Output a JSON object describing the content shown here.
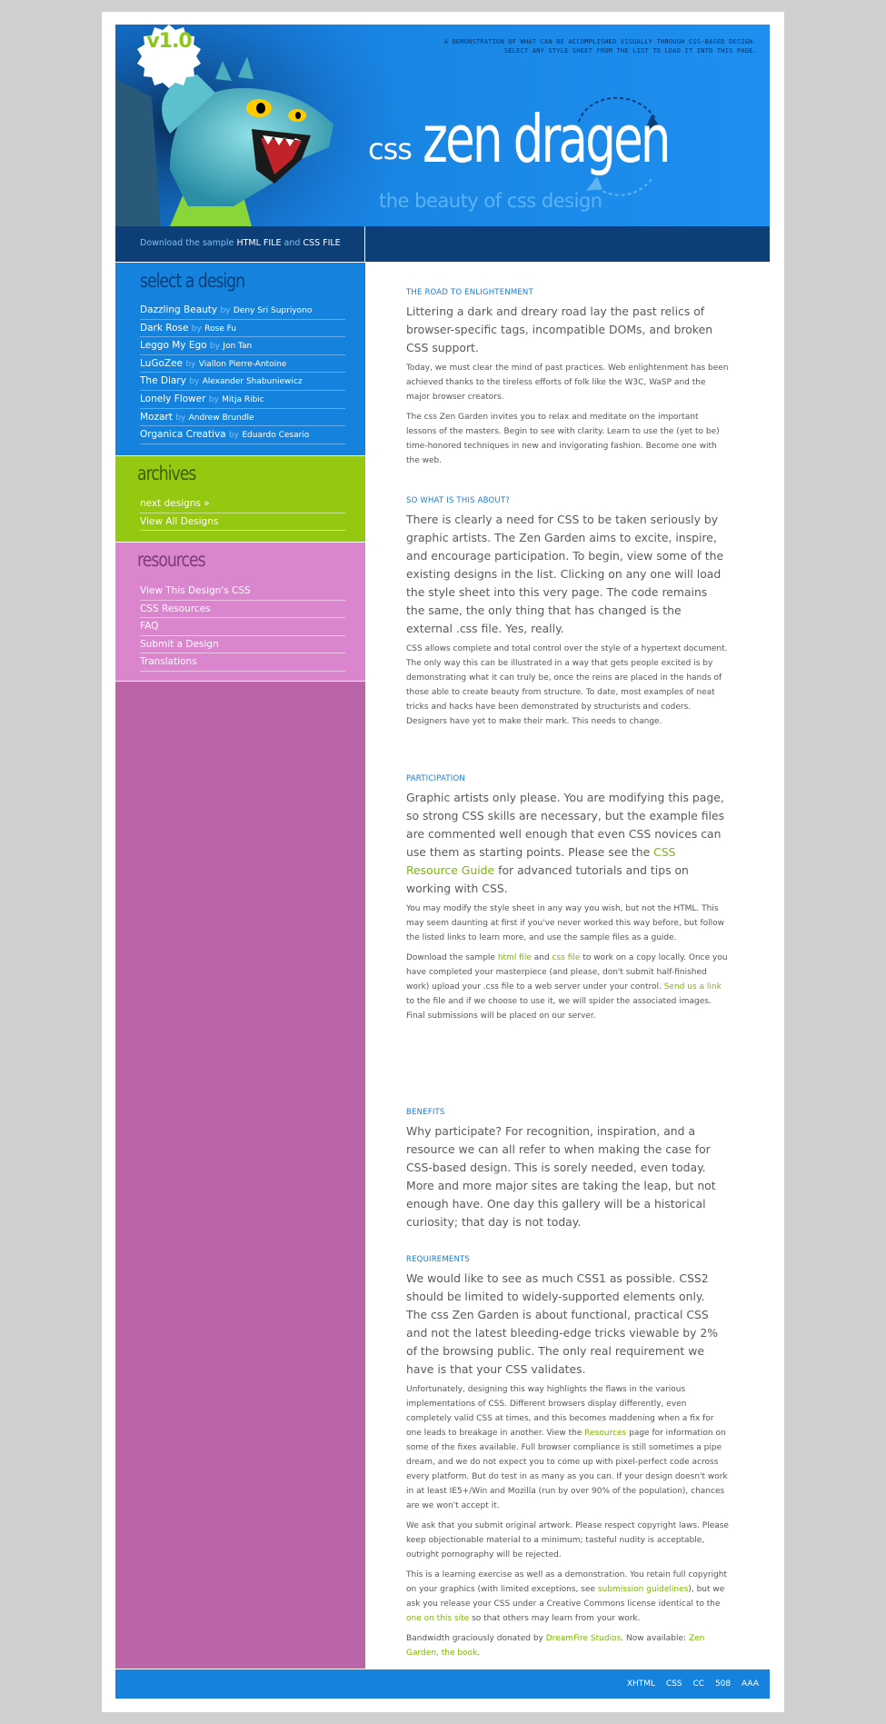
{
  "header": {
    "version": "v1.0",
    "summary": "A demonstration of what can be accomplished visually through CSS-based design. Select any style sheet from the list to load it into this page.",
    "logo_prefix": "css",
    "logo_main": "zen dragen",
    "tagline": "the beauty of css design"
  },
  "download": {
    "prefix": "Download the sample",
    "html_label": "HTML FILE",
    "and": "and",
    "css_label": "CSS FILE"
  },
  "sidebar": {
    "select_title": "select a design",
    "designs": [
      {
        "name": "Dazzling Beauty",
        "author": "Deny Sri Supriyono"
      },
      {
        "name": "Dark Rose",
        "author": "Rose Fu"
      },
      {
        "name": "Leggo My Ego",
        "author": "Jon Tan"
      },
      {
        "name": "LuGoZee",
        "author": "Viallon Pierre-Antoine"
      },
      {
        "name": "The Diary",
        "author": "Alexander Shabuniewicz"
      },
      {
        "name": "Lonely Flower",
        "author": "Mitja Ribic"
      },
      {
        "name": "Mozart",
        "author": "Andrew Brundle"
      },
      {
        "name": "Organica Creativa",
        "author": "Eduardo Cesario"
      }
    ],
    "by": "by",
    "archives_title": "archives",
    "archives": [
      "next designs »",
      "View All Designs"
    ],
    "resources_title": "resources",
    "resources": [
      "View This Design's CSS",
      "CSS Resources",
      "FAQ",
      "Submit a Design",
      "Translations"
    ]
  },
  "main": {
    "s1": {
      "title": "THE ROAD TO ENLIGHTENMENT",
      "lead": "Littering a dark and dreary road lay the past relics of browser-specific tags, incompatible DOMs, and broken CSS support.",
      "p1": "Today, we must clear the mind of past practices. Web enlightenment has been achieved thanks to the tireless efforts of folk like the W3C, WaSP and the major browser creators.",
      "p2": "The css Zen Garden invites you to relax and meditate on the important lessons of the masters. Begin to see with clarity. Learn to use the (yet to be) time-honored techniques in new and invigorating fashion. Become one with the web."
    },
    "s2": {
      "title": "SO WHAT IS THIS ABOUT?",
      "lead": "There is clearly a need for CSS to be taken seriously by graphic artists. The Zen Garden aims to excite, inspire, and encourage participation. To begin, view some of the existing designs in the list. Clicking on any one will load the style sheet into this very page. The code remains the same, the only thing that has changed is the external .css file. Yes, really.",
      "p1": "CSS allows complete and total control over the style of a hypertext document. The only way this can be illustrated in a way that gets people excited is by demonstrating what it can truly be, once the reins are placed in the hands of those able to create beauty from structure. To date, most examples of neat tricks and hacks have been demonstrated by structurists and coders. Designers have yet to make their mark. This needs to change."
    },
    "s3": {
      "title": "PARTICIPATION",
      "lead_a": "Graphic artists only please. You are modifying this page, so strong CSS skills are necessary, but the example files are commented well enough that even CSS novices can use them as starting points. Please see the ",
      "lead_link": "CSS Resource Guide",
      "lead_b": " for advanced tutorials and tips on working with CSS.",
      "p1": "You may modify the style sheet in any way you wish, but not the HTML. This may seem daunting at first if you've never worked this way before, but follow the listed links to learn more, and use the sample files as a guide.",
      "p2_a": "Download the sample ",
      "p2_link1": "html file",
      "p2_b": " and ",
      "p2_link2": "css file",
      "p2_c": " to work on a copy locally. Once you have completed your masterpiece (and please, don't submit half-finished work) upload your .css file to a web server under your control. ",
      "p2_link3": "Send us a link",
      "p2_d": " to the file and if we choose to use it, we will spider the associated images. Final submissions will be placed on our server."
    },
    "s4": {
      "title": "BENEFITS",
      "lead": "Why participate? For recognition, inspiration, and a resource we can all refer to when making the case for CSS-based design. This is sorely needed, even today. More and more major sites are taking the leap, but not enough have. One day this gallery will be a historical curiosity; that day is not today."
    },
    "s5": {
      "title": "REQUIREMENTS",
      "lead": "We would like to see as much CSS1 as possible. CSS2 should be limited to widely-supported elements only. The css Zen Garden is about functional, practical CSS and not the latest bleeding-edge tricks viewable by 2% of the browsing public. The only real requirement we have is that your CSS validates.",
      "p1_a": "Unfortunately, designing this way highlights the flaws in the various implementations of CSS. Different browsers display differently, even completely valid CSS at times, and this becomes maddening when a fix for one leads to breakage in another. View the ",
      "p1_link": "Resources",
      "p1_b": " page for information on some of the fixes available. Full browser compliance is still sometimes a pipe dream, and we do not expect you to come up with pixel-perfect code across every platform. But do test in as many as you can. If your design doesn't work in at least IE5+/Win and Mozilla (run by over 90% of the population), chances are we won't accept it.",
      "p2": "We ask that you submit original artwork. Please respect copyright laws. Please keep objectionable material to a minimum; tasteful nudity is acceptable, outright pornography will be rejected.",
      "p3_a": "This is a learning exercise as well as a demonstration. You retain full copyright on your graphics (with limited exceptions, see ",
      "p3_link1": "submission guidelines",
      "p3_b": "), but we ask you release your CSS under a Creative Commons license identical to the ",
      "p3_link2": "one on this site",
      "p3_c": " so that others may learn from your work.",
      "p4_a": "Bandwidth graciously donated by ",
      "p4_link1": "DreamFire Studios",
      "p4_b": ". Now available: ",
      "p4_link2": "Zen Garden, the book",
      "p4_c": "."
    }
  },
  "footer": {
    "links": [
      "XHTML",
      "CSS",
      "CC",
      "508",
      "AAA"
    ]
  },
  "colors": {
    "header_blue": "#1a86e4",
    "nav_dark": "#0d3e78",
    "select_blue": "#1583de",
    "archives_green": "#95c810",
    "resources_pink": "#dc85cf",
    "sidebar_purple": "#bb64a8",
    "heading_blue": "#1a7bd6",
    "link_green": "#7cb800"
  }
}
